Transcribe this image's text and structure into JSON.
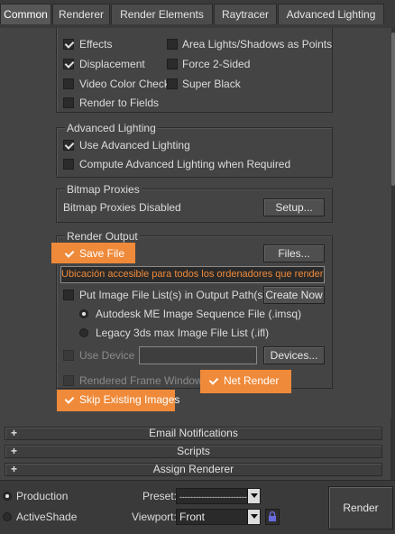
{
  "tabs": [
    {
      "label": "Common",
      "active": true
    },
    {
      "label": "Renderer",
      "active": false
    },
    {
      "label": "Render Elements",
      "active": false
    },
    {
      "label": "Raytracer",
      "active": false
    },
    {
      "label": "Advanced Lighting",
      "active": false
    }
  ],
  "options": {
    "effects": "Effects",
    "area_lights": "Area Lights/Shadows as Points",
    "displacement": "Displacement",
    "force_2sided": "Force 2-Sided",
    "video_color_check": "Video Color Check",
    "super_black": "Super Black",
    "render_to_fields": "Render to Fields"
  },
  "advanced_lighting": {
    "title": "Advanced Lighting",
    "use": "Use Advanced Lighting",
    "compute": "Compute Advanced Lighting when Required"
  },
  "bitmap_proxies": {
    "title": "Bitmap Proxies",
    "status": "Bitmap Proxies Disabled",
    "setup_button": "Setup..."
  },
  "render_output": {
    "title": "Render Output",
    "save_file": "Save File",
    "files_button": "Files...",
    "path": "Ubicación accesible para todos los ordenadores que renderizen",
    "put_image_list": "Put Image File List(s) in Output Path(s)",
    "create_now_button": "Create Now",
    "autodesk_sequence": "Autodesk ME Image Sequence File (.imsq)",
    "legacy_list": "Legacy 3ds max Image File List (.ifl)",
    "use_device": "Use Device",
    "devices_button": "Devices...",
    "rendered_frame_window": "Rendered Frame Window",
    "net_render": "Net Render",
    "skip_existing": "Skip Existing Images"
  },
  "rollouts": {
    "email": "Email Notifications",
    "scripts": "Scripts",
    "assign": "Assign Renderer",
    "plus": "+"
  },
  "bottom": {
    "production": "Production",
    "activeshade": "ActiveShade",
    "preset_label": "Preset:",
    "preset_value": "---------------------------",
    "viewport_label": "Viewport:",
    "viewport_value": "Front",
    "render_button": "Render"
  },
  "colors": {
    "highlight": "#ef8a3a",
    "path_text": "#ef8a3a"
  }
}
